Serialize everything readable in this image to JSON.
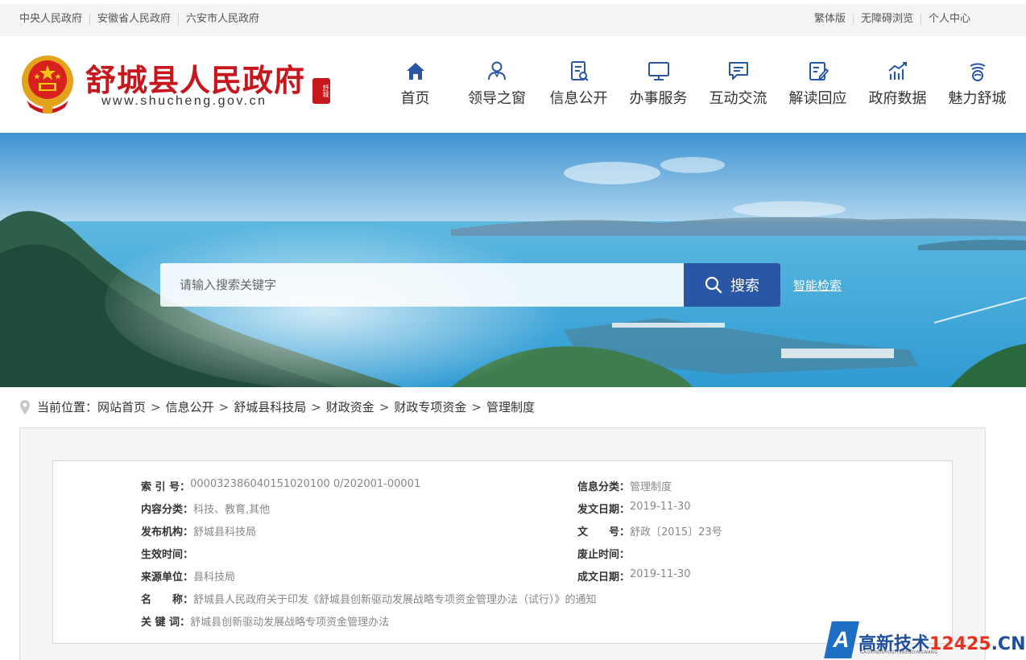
{
  "topbar": {
    "left_links": [
      "中央人民政府",
      "安徽省人民政府",
      "六安市人民政府"
    ],
    "right_links": [
      "繁体版",
      "无障碍浏览",
      "个人中心"
    ]
  },
  "header": {
    "site_name": "舒城县人民政府",
    "site_url": "www.shucheng.gov.cn",
    "seal_text": "舒城"
  },
  "nav": [
    {
      "label": "首页",
      "icon": "home-icon"
    },
    {
      "label": "领导之窗",
      "icon": "person-icon"
    },
    {
      "label": "信息公开",
      "icon": "document-icon"
    },
    {
      "label": "办事服务",
      "icon": "monitor-icon"
    },
    {
      "label": "互动交流",
      "icon": "chat-icon"
    },
    {
      "label": "解读回应",
      "icon": "edit-icon"
    },
    {
      "label": "政府数据",
      "icon": "chart-icon"
    },
    {
      "label": "魅力舒城",
      "icon": "landscape-icon"
    }
  ],
  "colors": {
    "brand_red": "#c8161d",
    "accent_blue": "#2a56a6",
    "nav_icon": "#2a56a6"
  },
  "search": {
    "placeholder": "请输入搜索关键字",
    "button_label": "搜索",
    "smart_search": "智能检索"
  },
  "breadcrumb": {
    "prefix": "当前位置：",
    "items": [
      "网站首页",
      "信息公开",
      "舒城县科技局",
      "财政资金",
      "财政专项资金",
      "管理制度"
    ],
    "separator": ">"
  },
  "info": {
    "index_no": {
      "label": "索 引 号：",
      "value": "000032386040151020100 0/202001-00001"
    },
    "category": {
      "label": "信息分类：",
      "value": "管理制度"
    },
    "content_class": {
      "label": "内容分类：",
      "value": "科技、教育,其他"
    },
    "issue_date": {
      "label": "发文日期：",
      "value": "2019-11-30"
    },
    "publisher": {
      "label": "发布机构：",
      "value": "舒城县科技局"
    },
    "doc_no": {
      "label": "文　　号：",
      "value": "舒政〔2015〕23号"
    },
    "effective": {
      "label": "生效时间：",
      "value": ""
    },
    "expired": {
      "label": "废止时间：",
      "value": ""
    },
    "source": {
      "label": "来源单位：",
      "value": "县科技局"
    },
    "written_date": {
      "label": "成文日期：",
      "value": "2019-11-30"
    },
    "title": {
      "label": "名　　称：",
      "value": "舒城县人民政府关于印发《舒城县创新驱动发展战略专项资金管理办法（试行）》的通知"
    },
    "keywords": {
      "label": "关 键 词：",
      "value": "舒城县创新驱动发展战略专项资金管理办法"
    }
  },
  "watermark": {
    "letter": "A",
    "title_a": "高新技术",
    "title_b": "12425",
    "title_c": ".CN",
    "sub": "GAOXINJISHUQIYERENDINGWANG"
  }
}
